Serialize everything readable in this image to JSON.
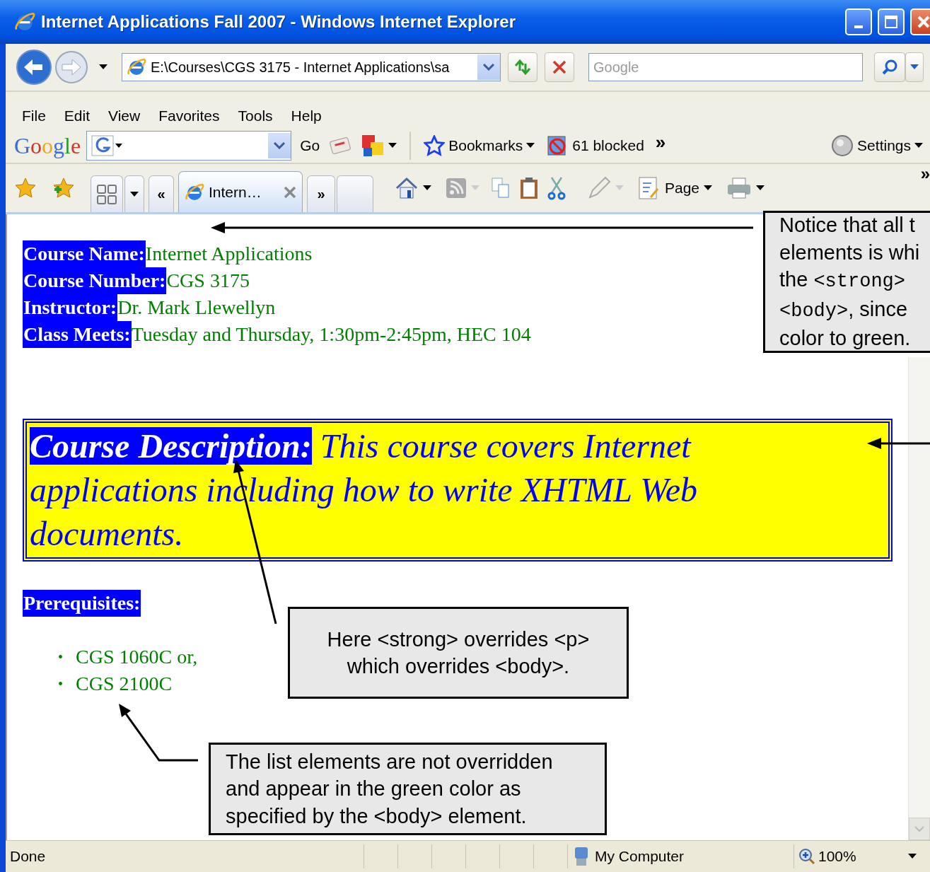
{
  "window": {
    "title": "Internet Applications Fall 2007 - Windows Internet Explorer"
  },
  "address_bar": {
    "value": "E:\\Courses\\CGS 3175 - Internet Applications\\sa"
  },
  "search": {
    "placeholder": "Google"
  },
  "menu": [
    "File",
    "Edit",
    "View",
    "Favorites",
    "Tools",
    "Help"
  ],
  "google_toolbar": {
    "logo": "Google",
    "go": "Go",
    "bookmarks": "Bookmarks",
    "blocked": "61 blocked",
    "more": "»",
    "settings": "Settings"
  },
  "tab_bar": {
    "scroll_left": "«",
    "scroll_right": "»",
    "tabs": [
      {
        "label": "Intern…",
        "selected": true
      }
    ]
  },
  "command_bar": {
    "page": "Page",
    "more": "»"
  },
  "page": {
    "fields": [
      {
        "label": "Course Name:",
        "value": "Internet Applications"
      },
      {
        "label": "Course Number:",
        "value": "CGS 3175"
      },
      {
        "label": "Instructor:",
        "value": "Dr. Mark Llewellyn"
      },
      {
        "label": "Class Meets:",
        "value": "Tuesday and Thursday, 1:30pm-2:45pm, HEC 104"
      }
    ],
    "description": {
      "label": "Course Description:",
      "text": "This course covers Internet applications including how to write XHTML Web documents."
    },
    "prerequisites": {
      "label": "Prerequisites:",
      "items": [
        {
          "bullet": "•",
          "text": "CGS 1060C or,"
        },
        {
          "bullet": "•",
          "text": "CGS 2100C"
        }
      ]
    }
  },
  "annotations": [
    {
      "kind": "edge",
      "lines": [
        [
          {
            "kind": "text",
            "text": "Notice that all t"
          }
        ],
        [
          {
            "kind": "text",
            "text": "elements is whi"
          }
        ],
        [
          {
            "kind": "text",
            "text": "the "
          },
          {
            "kind": "code",
            "text": "<strong>"
          }
        ],
        [
          {
            "kind": "code",
            "text": "<body>"
          },
          {
            "kind": "text",
            "text": ", since"
          }
        ],
        [
          {
            "kind": "text",
            "text": "color to green."
          }
        ]
      ]
    },
    {
      "kind": "center",
      "lines": [
        [
          {
            "kind": "text",
            "text": "Here <strong> overrides <p>"
          }
        ],
        [
          {
            "kind": "text",
            "text": "which overrides <body>."
          }
        ]
      ]
    },
    {
      "kind": "left",
      "lines": [
        [
          {
            "kind": "text",
            "text": "The list elements are not overridden"
          }
        ],
        [
          {
            "kind": "text",
            "text": "and appear in the green color as"
          }
        ],
        [
          {
            "kind": "text",
            "text": "specified by the <body> element."
          }
        ]
      ]
    }
  ],
  "status_bar": {
    "text": "Done",
    "zone": "My Computer",
    "zoom": "100%"
  }
}
